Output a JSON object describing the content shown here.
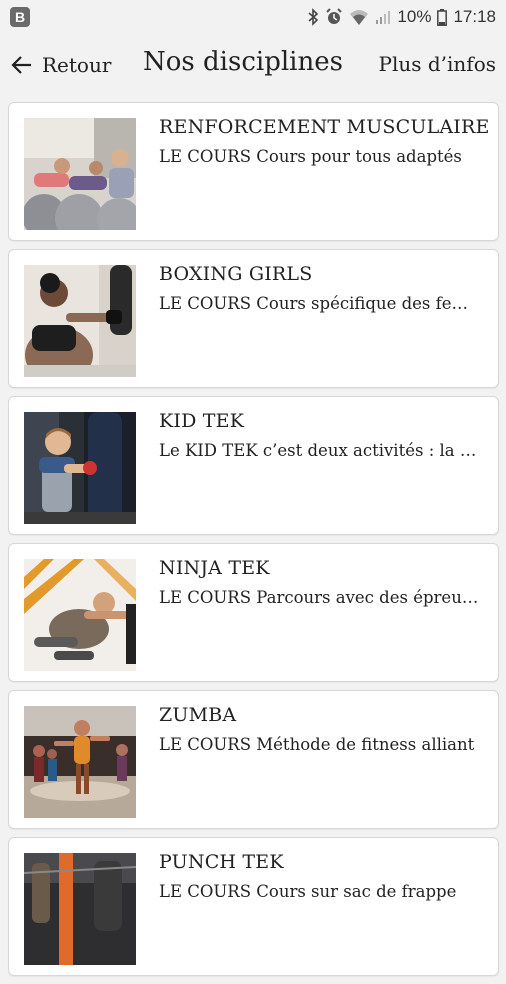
{
  "status_bar": {
    "app_badge": "B",
    "battery": "10%",
    "time": "17:18"
  },
  "header": {
    "back_label": "Retour",
    "title": "Nos disciplines",
    "more_label": "Plus d’infos"
  },
  "disciplines": [
    {
      "title": "RENFORCEMENT MUSCULAIRE",
      "description": "LE COURS Cours pour tous adaptés"
    },
    {
      "title": "BOXING GIRLS",
      "description": " LE COURS Cours spécifique des femmes"
    },
    {
      "title": "KID TEK",
      "description": "Le KID TEK c’est deux activités : la boxe"
    },
    {
      "title": "NINJA TEK",
      "description": "LE COURS Parcours avec des épreuves"
    },
    {
      "title": "ZUMBA",
      "description": "LE COURS Méthode de fitness alliant"
    },
    {
      "title": "PUNCH TEK",
      "description": "LE COURS Cours sur sac de frappe"
    }
  ]
}
